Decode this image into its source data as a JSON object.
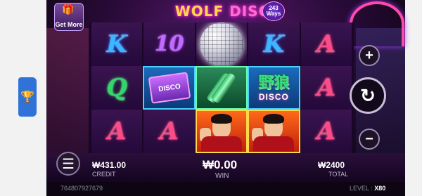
{
  "app": {
    "get_more_label": "Get More",
    "logo_wolf": "WOLF",
    "logo_disco": "DISCO",
    "ways_number": "243",
    "ways_label": "Ways"
  },
  "reels": {
    "rows": [
      [
        "K",
        "10",
        "disco-ball",
        "K",
        "A"
      ],
      [
        "Q",
        "cassette",
        "bottles",
        "wild",
        "A"
      ],
      [
        "A",
        "A",
        "singer",
        "singer",
        "A"
      ]
    ],
    "cassette_text": "DISCO",
    "wild_cn": "野狼",
    "wild_en": "DISCO"
  },
  "hud": {
    "credit_value": "₩431.00",
    "credit_label": "CREDIT",
    "win_value": "₩0.00",
    "win_label": "WIN",
    "total_value": "₩2400",
    "total_label": "TOTAL",
    "plus_symbol": "+",
    "minus_symbol": "−",
    "spin_symbol": "↻",
    "menu_symbol": "☰"
  },
  "footer": {
    "reference": "764807927679",
    "level_label": "LEVEL :",
    "level_value": "X80"
  },
  "colors": {
    "accent_pink": "#ff4aa8",
    "accent_gold": "#ffd84a",
    "side_tab_blue": "#2f73d8"
  },
  "icons": {
    "side_tab": "trophy-icon",
    "menu": "hamburger-icon",
    "spin": "refresh-icon"
  }
}
